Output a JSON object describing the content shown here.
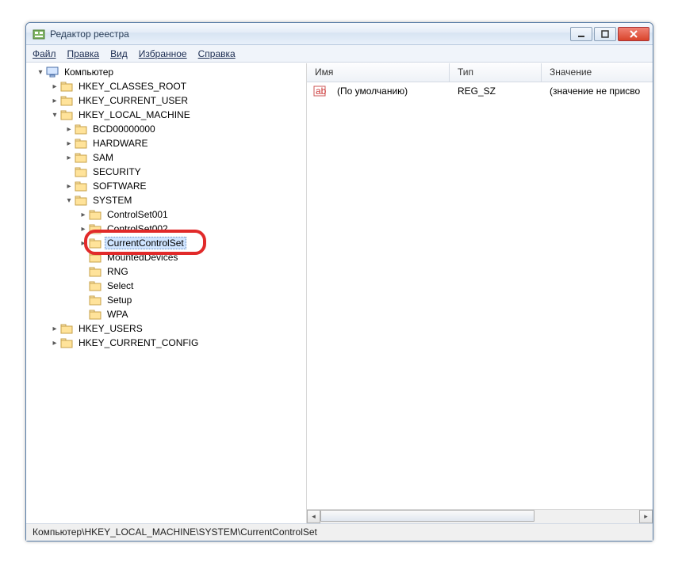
{
  "window": {
    "title": "Редактор реестра"
  },
  "win_buttons": {
    "min_name": "minimize",
    "max_name": "maximize",
    "close_name": "close"
  },
  "menu": {
    "file": "Файл",
    "edit": "Правка",
    "view": "Вид",
    "favorites": "Избранное",
    "help": "Справка"
  },
  "tree": {
    "root": "Компьютер",
    "hklm": "HKEY_LOCAL_MACHINE",
    "hkcr": "HKEY_CLASSES_ROOT",
    "hkcu": "HKEY_CURRENT_USER",
    "hku": "HKEY_USERS",
    "hkcc": "HKEY_CURRENT_CONFIG",
    "system": "SYSTEM",
    "hklm_children": {
      "bcd": "BCD00000000",
      "hardware": "HARDWARE",
      "sam": "SAM",
      "security": "SECURITY",
      "software": "SOFTWARE"
    },
    "system_children": {
      "cs001": "ControlSet001",
      "cs002": "ControlSet002",
      "ccs": "CurrentControlSet",
      "mounted": "MountedDevices",
      "rng": "RNG",
      "select": "Select",
      "setup": "Setup",
      "wpa": "WPA"
    }
  },
  "columns": {
    "name": "Имя",
    "type": "Тип",
    "value": "Значение"
  },
  "row_default": {
    "name": "(По умолчанию)",
    "type": "REG_SZ",
    "value": "(значение не присво"
  },
  "statusbar": "Компьютер\\HKEY_LOCAL_MACHINE\\SYSTEM\\CurrentControlSet",
  "colors": {
    "highlight": "#e12a2a"
  }
}
